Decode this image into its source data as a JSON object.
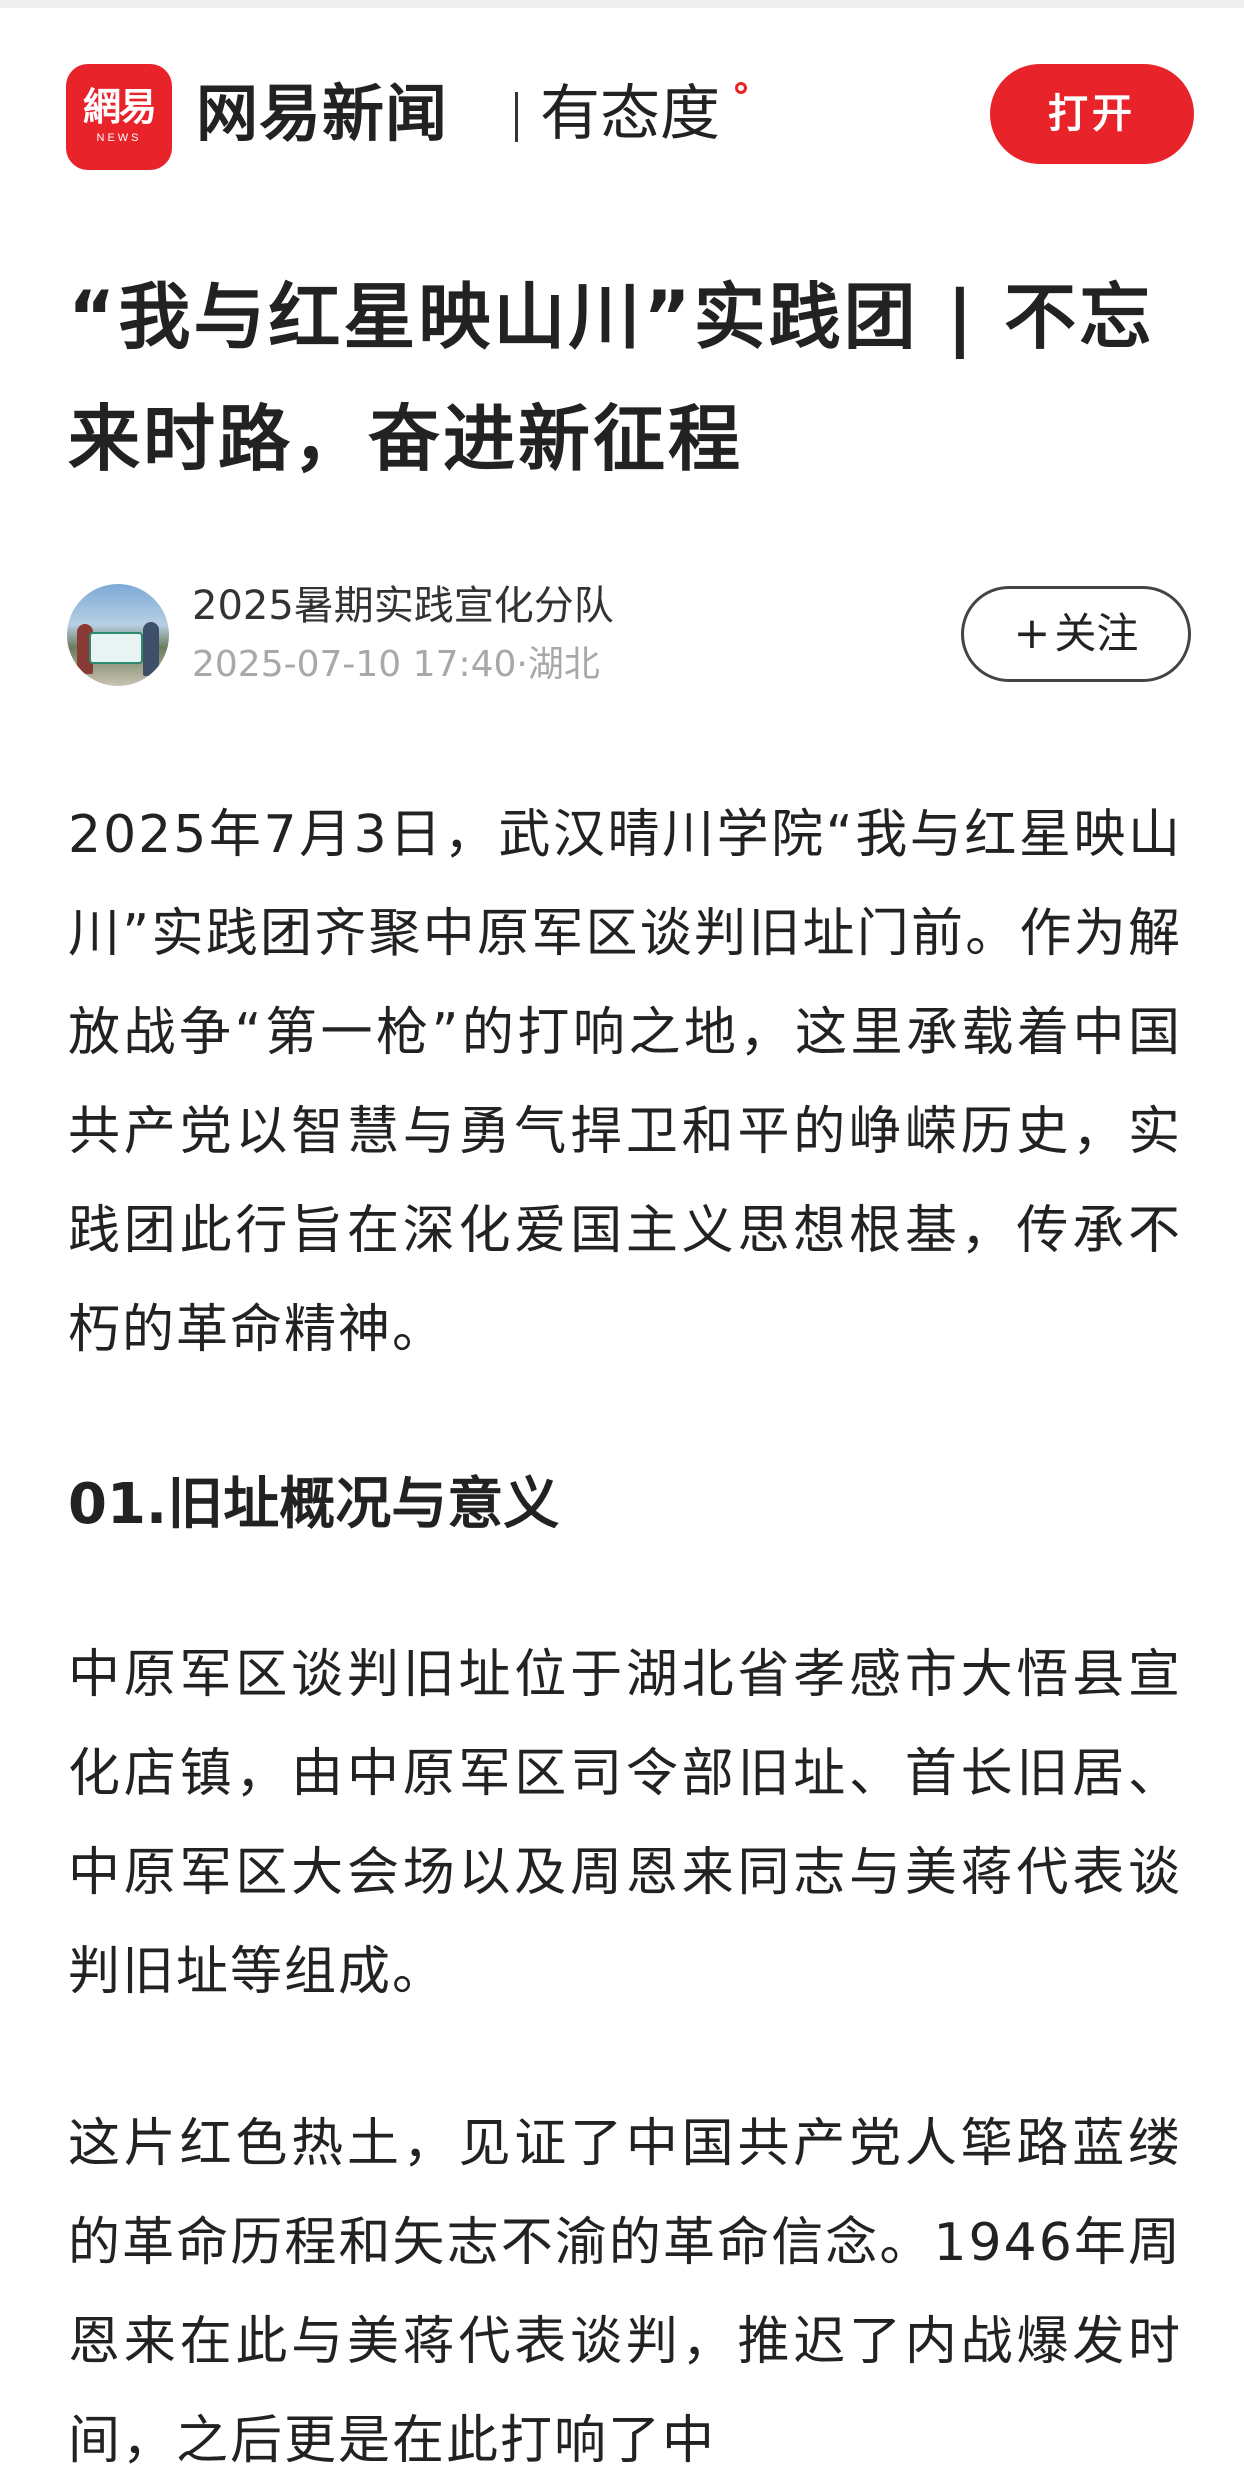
{
  "header": {
    "logo_mark": "網易",
    "logo_sub": "NEWS",
    "brand_name": "网易新闻",
    "slogan": "有态度",
    "open_button": "打开"
  },
  "article": {
    "title": "“我与红星映山川”实践团 | 不忘来时路，奋进新征程",
    "author": {
      "name": "2025暑期实践宣化分队",
      "date": "2025-07-10 17:40",
      "separator": "·",
      "location": "湖北"
    },
    "follow_label": "关注",
    "paragraphs": [
      "2025年7月3日，武汉晴川学院“我与红星映山川”实践团齐聚中原军区谈判旧址门前。作为解放战争“第一枪”的打响之地，这里承载着中国共产党以智慧与勇气捍卫和平的峥嵘历史，实践团此行旨在深化爱国主义思想根基，传承不朽的革命精神。",
      "中原军区谈判旧址位于湖北省孝感市大悟县宣化店镇，由中原军区司令部旧址、首长旧居、中原军区大会场以及周恩来同志与美蒋代表谈判旧址等组成。",
      "这片红色热土，见证了中国共产党人筚路蓝缕的革命历程和矢志不渝的革命信念。1946年周恩来在此与美蒋代表谈判，推迟了内战爆发时间，之后更是在此打响了中"
    ],
    "section_heading": "01.旧址概况与意义"
  },
  "colors": {
    "brand_red": "#e8232a",
    "meta_gray": "#a8a8a8",
    "text": "#222222"
  },
  "icons": {
    "follow": "plus-icon",
    "logo": "netease-news-logo"
  }
}
